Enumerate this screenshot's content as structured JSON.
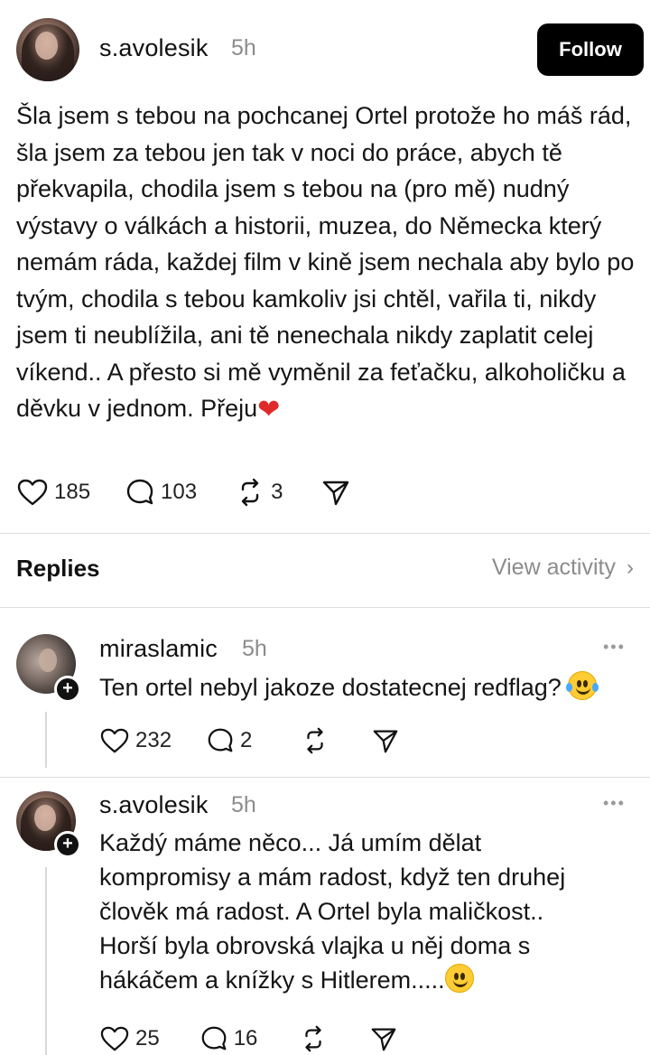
{
  "post": {
    "username": "s.avolesik",
    "time": "5h",
    "follow_label": "Follow",
    "text": "Šla jsem s tebou na pochcanej Ortel protože ho máš rád, šla jsem za tebou jen tak v noci do práce, abych tě překvapila, chodila jsem s tebou na (pro mě) nudný výstavy o válkách a historii, muzea, do Německa který nemám ráda, každej film v kině jsem nechala aby bylo po tvým, chodila s tebou kamkoliv jsi chtěl, vařila ti, nikdy jsem ti neublížila, ani tě nenechala nikdy zaplatit celej víkend.. A přesto si mě vyměnil za feťačku, alkoholičku a děvku v jednom. Přeju",
    "emoji": "❤",
    "likes": "185",
    "comments": "103",
    "reposts": "3"
  },
  "replies_section": {
    "title": "Replies",
    "view_activity": "View activity",
    "chevron": "›"
  },
  "replies": [
    {
      "username": "miraslamic",
      "time": "5h",
      "text": "Ten ortel nebyl jakoze dostatecnej redflag?",
      "emoji": "face-with-tears-of-joy",
      "likes": "232",
      "comments": "2",
      "reposts": ""
    },
    {
      "username": "s.avolesik",
      "time": "5h",
      "text": "Každý máme něco... Já umím dělat kompromisy a mám radost, když ten druhej člověk má radost. A Ortel byla maličkost.. Horší byla obrovská vlajka u něj doma s hákáčem a knížky s Hitlerem.....",
      "emoji": "smiling-face",
      "likes": "25",
      "comments": "16",
      "reposts": ""
    }
  ],
  "icons": {
    "like": "heart-outline-icon",
    "comment": "speech-bubble-icon",
    "repost": "repost-arrows-icon",
    "share": "send-paper-plane-icon",
    "more": "more-dots-icon",
    "follow_badge": "plus-icon"
  },
  "badge_symbol": "+",
  "more_symbol": "•••"
}
